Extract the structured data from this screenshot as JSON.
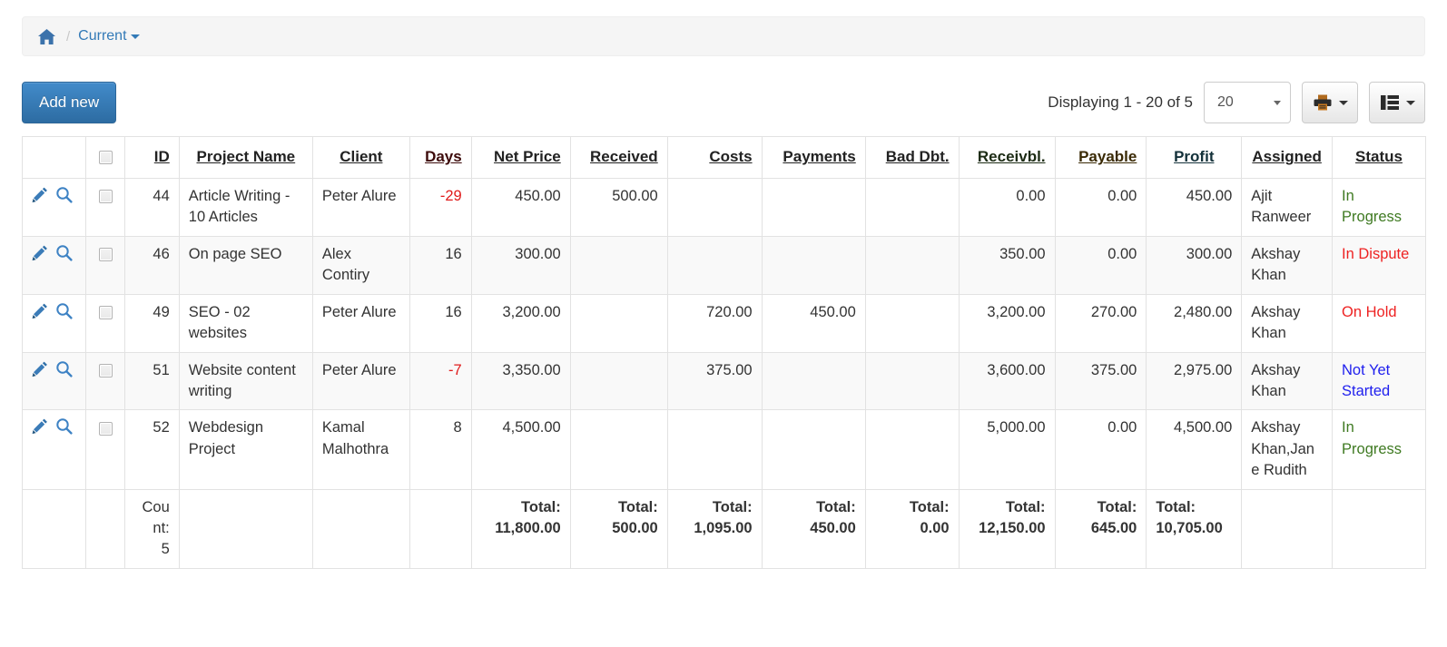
{
  "breadcrumb": {
    "home_icon": "home-icon",
    "separator": "/",
    "current_label": "Current"
  },
  "toolbar": {
    "add_new_label": "Add new",
    "displaying_text": "Displaying 1 - 20 of 5",
    "page_size_value": "20",
    "page_size_options": [
      "20"
    ],
    "print_icon": "printer-icon",
    "columns_icon": "table-columns-icon"
  },
  "table": {
    "select_all_label": "",
    "columns": [
      {
        "key": "actions",
        "label": ""
      },
      {
        "key": "select",
        "label": ""
      },
      {
        "key": "id",
        "label": "ID"
      },
      {
        "key": "name",
        "label": "Project Name"
      },
      {
        "key": "client",
        "label": "Client"
      },
      {
        "key": "days",
        "label": "Days"
      },
      {
        "key": "net",
        "label": "Net Price"
      },
      {
        "key": "received",
        "label": "Received"
      },
      {
        "key": "costs",
        "label": "Costs"
      },
      {
        "key": "payments",
        "label": "Payments"
      },
      {
        "key": "baddebt",
        "label": "Bad Dbt."
      },
      {
        "key": "receivbl",
        "label": "Receivbl."
      },
      {
        "key": "payable",
        "label": "Payable"
      },
      {
        "key": "profit",
        "label": "Profit"
      },
      {
        "key": "assigned",
        "label": "Assigned"
      },
      {
        "key": "status",
        "label": "Status"
      }
    ],
    "header_colors": {
      "days": "#f90000",
      "receivbl": "#3fcf30",
      "payable": "#ffd21e",
      "profit": "#5ad9cc"
    },
    "row_icons": {
      "edit": "pencil-icon",
      "view": "magnifier-icon"
    },
    "rows": [
      {
        "id": "44",
        "name": "Article Writing - 10 Articles",
        "client": "Peter Alure",
        "days": "-29",
        "days_negative": true,
        "net": "450.00",
        "received": "500.00",
        "costs": "",
        "payments": "",
        "baddebt": "",
        "receivbl": "0.00",
        "payable": "0.00",
        "profit": "450.00",
        "assigned": "Ajit Ranweer",
        "status": "In Progress",
        "status_color": "green"
      },
      {
        "id": "46",
        "name": "On page SEO",
        "client": "Alex Contiry",
        "days": "16",
        "days_negative": false,
        "net": "300.00",
        "received": "",
        "costs": "",
        "payments": "",
        "baddebt": "",
        "receivbl": "350.00",
        "payable": "0.00",
        "profit": "300.00",
        "assigned": "Akshay Khan",
        "status": "In Dispute",
        "status_color": "red"
      },
      {
        "id": "49",
        "name": "SEO - 02 websites",
        "client": "Peter Alure",
        "days": "16",
        "days_negative": false,
        "net": "3,200.00",
        "received": "",
        "costs": "720.00",
        "payments": "450.00",
        "baddebt": "",
        "receivbl": "3,200.00",
        "payable": "270.00",
        "profit": "2,480.00",
        "assigned": "Akshay Khan",
        "status": "On Hold",
        "status_color": "red"
      },
      {
        "id": "51",
        "name": "Website content writing",
        "client": "Peter Alure",
        "days": "-7",
        "days_negative": true,
        "net": "3,350.00",
        "received": "",
        "costs": "375.00",
        "payments": "",
        "baddebt": "",
        "receivbl": "3,600.00",
        "payable": "375.00",
        "profit": "2,975.00",
        "assigned": "Akshay Khan",
        "status": "Not Yet Started",
        "status_color": "blue"
      },
      {
        "id": "52",
        "name": "Webdesign Project",
        "client": "Kamal Malhothra",
        "days": "8",
        "days_negative": false,
        "net": "4,500.00",
        "received": "",
        "costs": "",
        "payments": "",
        "baddebt": "",
        "receivbl": "5,000.00",
        "payable": "0.00",
        "profit": "4,500.00",
        "assigned": "Akshay Khan,Jane Rudith",
        "status": "In Progress",
        "status_color": "green"
      }
    ],
    "footer": {
      "count_label": "Count:",
      "count_value": "5",
      "total_label": "Total:",
      "totals": {
        "net": "11,800.00",
        "received": "500.00",
        "costs": "1,095.00",
        "payments": "450.00",
        "baddebt": "0.00",
        "receivbl": "12,150.00",
        "payable": "645.00",
        "profit": "10,705.00"
      }
    }
  }
}
